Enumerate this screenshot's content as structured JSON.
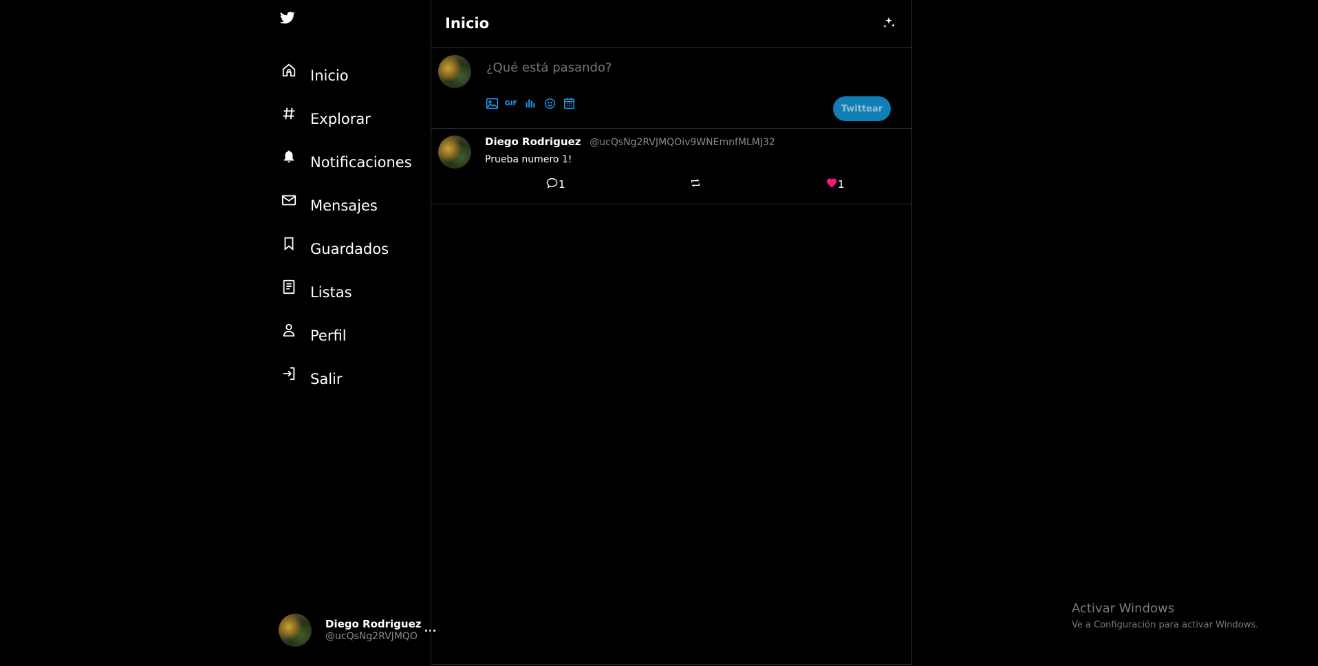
{
  "app": {
    "logo_icon": "twitter-bird-icon",
    "accent": "#1d9bf0",
    "like_color": "#f91880"
  },
  "sidebar": {
    "items": [
      {
        "label": "Inicio",
        "icon": "home-icon"
      },
      {
        "label": "Explorar",
        "icon": "hashtag-icon"
      },
      {
        "label": "Notificaciones",
        "icon": "bell-icon"
      },
      {
        "label": "Mensajes",
        "icon": "mail-icon"
      },
      {
        "label": "Guardados",
        "icon": "bookmark-icon"
      },
      {
        "label": "Listas",
        "icon": "list-icon"
      },
      {
        "label": "Perfil",
        "icon": "user-icon"
      },
      {
        "label": "Salir",
        "icon": "logout-icon"
      }
    ],
    "account": {
      "name": "Diego Rodriguez",
      "handle": "@ucQsNg2RVJMQO",
      "more": "..."
    }
  },
  "main": {
    "title": "Inicio",
    "composer": {
      "placeholder": "¿Qué está pasando?",
      "gif_label": "GIF",
      "tweet_button": "Twittear"
    },
    "tweets": [
      {
        "name": "Diego Rodriguez",
        "handle": "@ucQsNg2RVJMQOiv9WNEmnfMLMJ32",
        "text": "Prueba numero 1!",
        "replies": "1",
        "likes": "1"
      }
    ]
  },
  "watermark": {
    "title": "Activar Windows",
    "subtitle": "Ve a Configuración para activar Windows."
  }
}
